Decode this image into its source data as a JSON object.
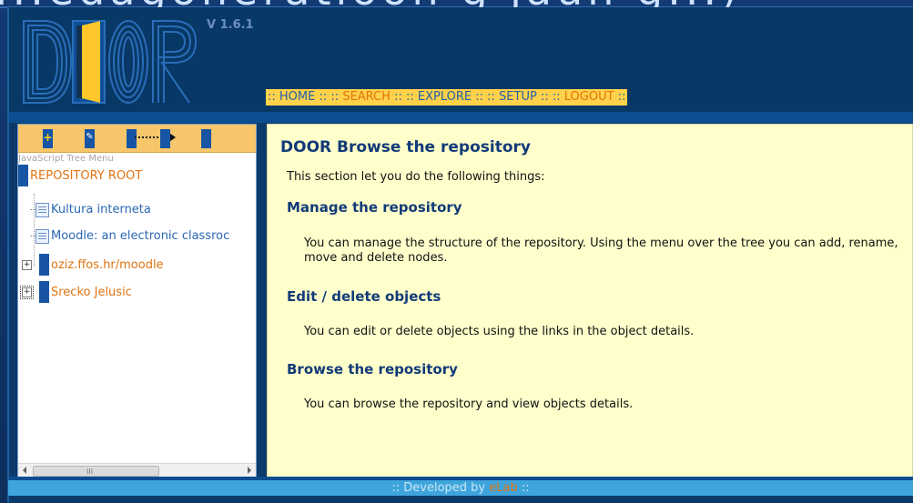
{
  "slide": {
    "title": "...edagoneratioon g jaun g...)"
  },
  "app": {
    "logo_text": "DOOR",
    "version": "V 1.6.1",
    "nav": {
      "home": "HOME",
      "search": "SEARCH",
      "explore": "EXPLORE",
      "setup": "SETUP",
      "logout": "LOGOUT",
      "separator": "::"
    },
    "colors": {
      "nav_bar": "#ffd24a",
      "accent_orange": "#e07412",
      "link_blue": "#2b67b3",
      "content_bg": "#ffffcc",
      "header_bg": "#083866"
    }
  },
  "tree": {
    "toolbar": {
      "buttons": [
        {
          "name": "add-node-icon",
          "glyph": "+"
        },
        {
          "name": "rename-node-icon",
          "glyph": "✎"
        },
        {
          "name": "move-node-icon",
          "glyph": ""
        },
        {
          "name": "move-target-icon",
          "glyph": ""
        },
        {
          "name": "delete-node-icon",
          "glyph": ""
        }
      ]
    },
    "caption": "JavaScript Tree Menu",
    "root": "REPOSITORY ROOT",
    "items": [
      {
        "label": "Kultura interneta",
        "type": "document",
        "color": "blue"
      },
      {
        "label": "Moodle: an electronic classroc",
        "type": "document",
        "color": "blue"
      },
      {
        "label": "oziz.ffos.hr/moodle",
        "type": "folder",
        "color": "orange"
      },
      {
        "label": "Srecko Jelusic",
        "type": "folder",
        "color": "orange"
      }
    ],
    "scroll_grip": "III"
  },
  "content": {
    "title": "DOOR Browse the repository",
    "intro": "This section let you do the following things:",
    "sections": [
      {
        "heading": "Manage the repository",
        "text": "You can manage the structure of the repository. Using the menu over the tree you can add, rename, move and delete nodes."
      },
      {
        "heading": "Edit / delete objects",
        "text": "You can edit or delete objects using the links in the object details."
      },
      {
        "heading": "Browse the repository",
        "text": "You can browse the repository and view objects details."
      }
    ]
  },
  "footer": {
    "prefix": ":: Developed by",
    "link": "eLab",
    "suffix": "::"
  }
}
